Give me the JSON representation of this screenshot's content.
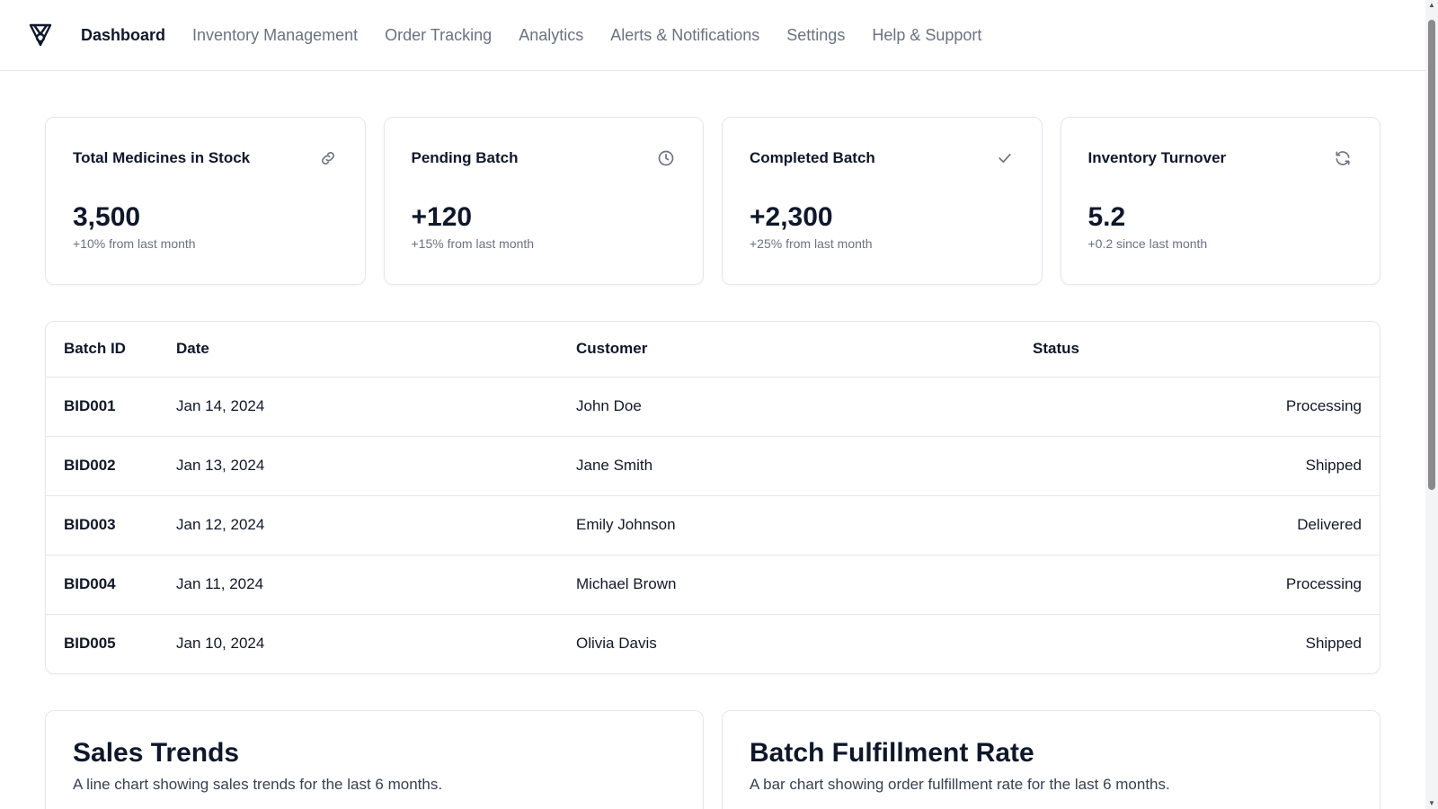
{
  "nav": {
    "logo_icon": "medical-shield-icon",
    "links": [
      {
        "label": "Dashboard",
        "active": true
      },
      {
        "label": "Inventory Management",
        "active": false
      },
      {
        "label": "Order Tracking",
        "active": false
      },
      {
        "label": "Analytics",
        "active": false
      },
      {
        "label": "Alerts & Notifications",
        "active": false
      },
      {
        "label": "Settings",
        "active": false
      },
      {
        "label": "Help & Support",
        "active": false
      }
    ]
  },
  "stats": [
    {
      "title": "Total Medicines in Stock",
      "icon": "link-icon",
      "value": "3,500",
      "sub": "+10% from last month"
    },
    {
      "title": "Pending Batch",
      "icon": "clock-icon",
      "value": "+120",
      "sub": "+15% from last month"
    },
    {
      "title": "Completed Batch",
      "icon": "check-icon",
      "value": "+2,300",
      "sub": "+25% from last month"
    },
    {
      "title": "Inventory Turnover",
      "icon": "refresh-icon",
      "value": "5.2",
      "sub": "+0.2 since last month"
    }
  ],
  "table": {
    "headers": {
      "batch_id": "Batch ID",
      "date": "Date",
      "customer": "Customer",
      "status": "Status"
    },
    "rows": [
      {
        "batch_id": "BID001",
        "date": "Jan 14, 2024",
        "customer": "John Doe",
        "status": "Processing"
      },
      {
        "batch_id": "BID002",
        "date": "Jan 13, 2024",
        "customer": "Jane Smith",
        "status": "Shipped"
      },
      {
        "batch_id": "BID003",
        "date": "Jan 12, 2024",
        "customer": "Emily Johnson",
        "status": "Delivered"
      },
      {
        "batch_id": "BID004",
        "date": "Jan 11, 2024",
        "customer": "Michael Brown",
        "status": "Processing"
      },
      {
        "batch_id": "BID005",
        "date": "Jan 10, 2024",
        "customer": "Olivia Davis",
        "status": "Shipped"
      }
    ]
  },
  "charts": {
    "sales": {
      "title": "Sales Trends",
      "description": "A line chart showing sales trends for the last 6 months."
    },
    "fulfillment": {
      "title": "Batch Fulfillment Rate",
      "description": "A bar chart showing order fulfillment rate for the last 6 months."
    }
  }
}
